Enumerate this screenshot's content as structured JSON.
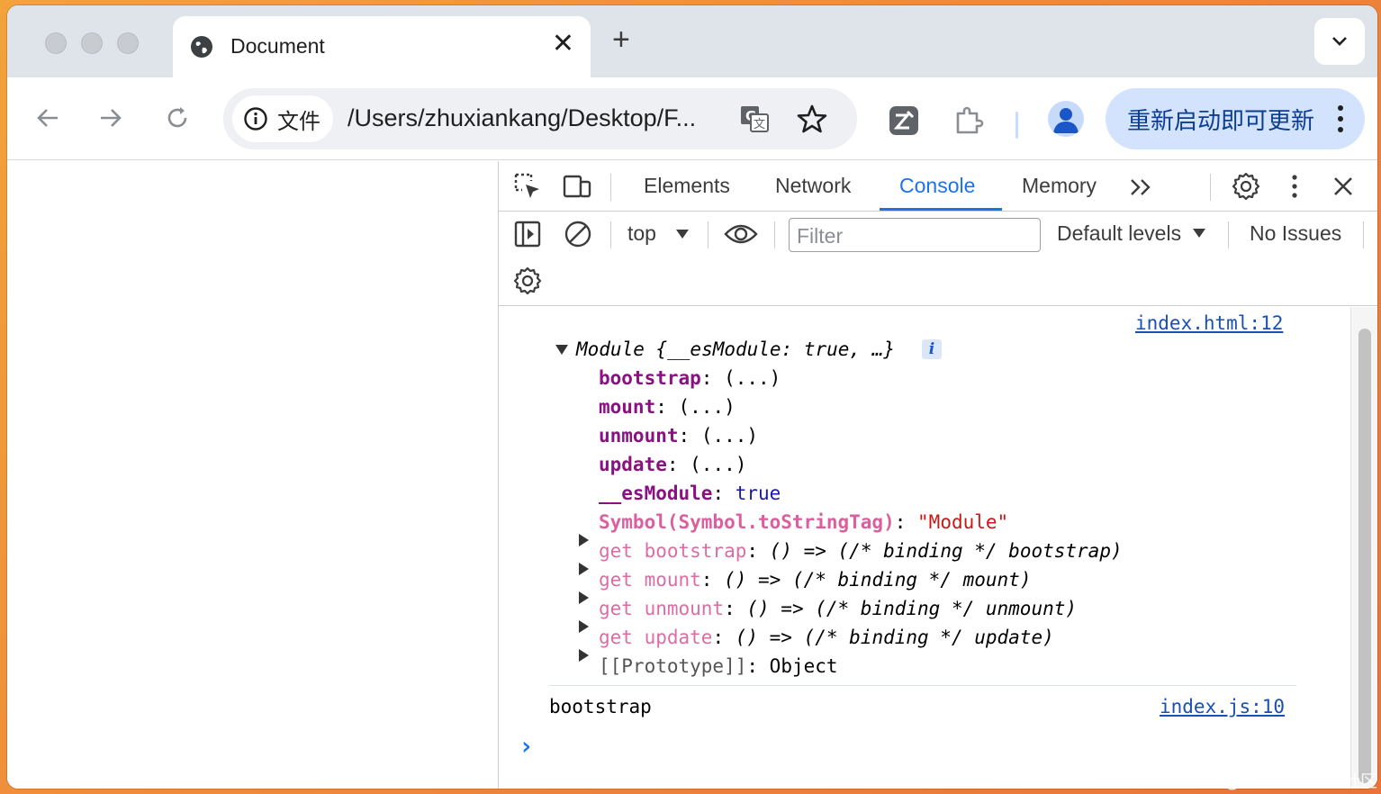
{
  "tab": {
    "title": "Document"
  },
  "omnibox": {
    "site_label": "文件",
    "url": "/Users/zhuxiankang/Desktop/F..."
  },
  "update_button": {
    "label": "重新启动即可更新"
  },
  "devtools": {
    "tabs": [
      "Elements",
      "Network",
      "Console",
      "Memory"
    ],
    "active_tab": "Console",
    "context": "top",
    "filter_placeholder": "Filter",
    "levels": "Default levels",
    "issues": "No Issues"
  },
  "console": {
    "source1": "index.html:12",
    "object_header": "Module {__esModule: true, …}",
    "info_badge": "i",
    "props": [
      {
        "key": "bootstrap",
        "value": "(...)"
      },
      {
        "key": "mount",
        "value": "(...)"
      },
      {
        "key": "unmount",
        "value": "(...)"
      },
      {
        "key": "update",
        "value": "(...)"
      }
    ],
    "esmodule_key": "__esModule",
    "esmodule_value": "true",
    "symbol_key": "Symbol(Symbol.toStringTag)",
    "symbol_value": "\"Module\"",
    "getters": [
      {
        "key": "get bootstrap",
        "value": "() => (/* binding */ bootstrap)"
      },
      {
        "key": "get mount",
        "value": "() => (/* binding */ mount)"
      },
      {
        "key": "get unmount",
        "value": "() => (/* binding */ unmount)"
      },
      {
        "key": "get update",
        "value": "() => (/* binding */ update)"
      }
    ],
    "prototype_key": "[[Prototype]]",
    "prototype_value": "Object",
    "log2_text": "bootstrap",
    "source2": "index.js:10",
    "prompt": "›"
  },
  "watermark": "@稀土掘金技术社区",
  "colors": {
    "accent": "#1a73e8",
    "key_purple": "#881280",
    "string_red": "#c41a16"
  }
}
